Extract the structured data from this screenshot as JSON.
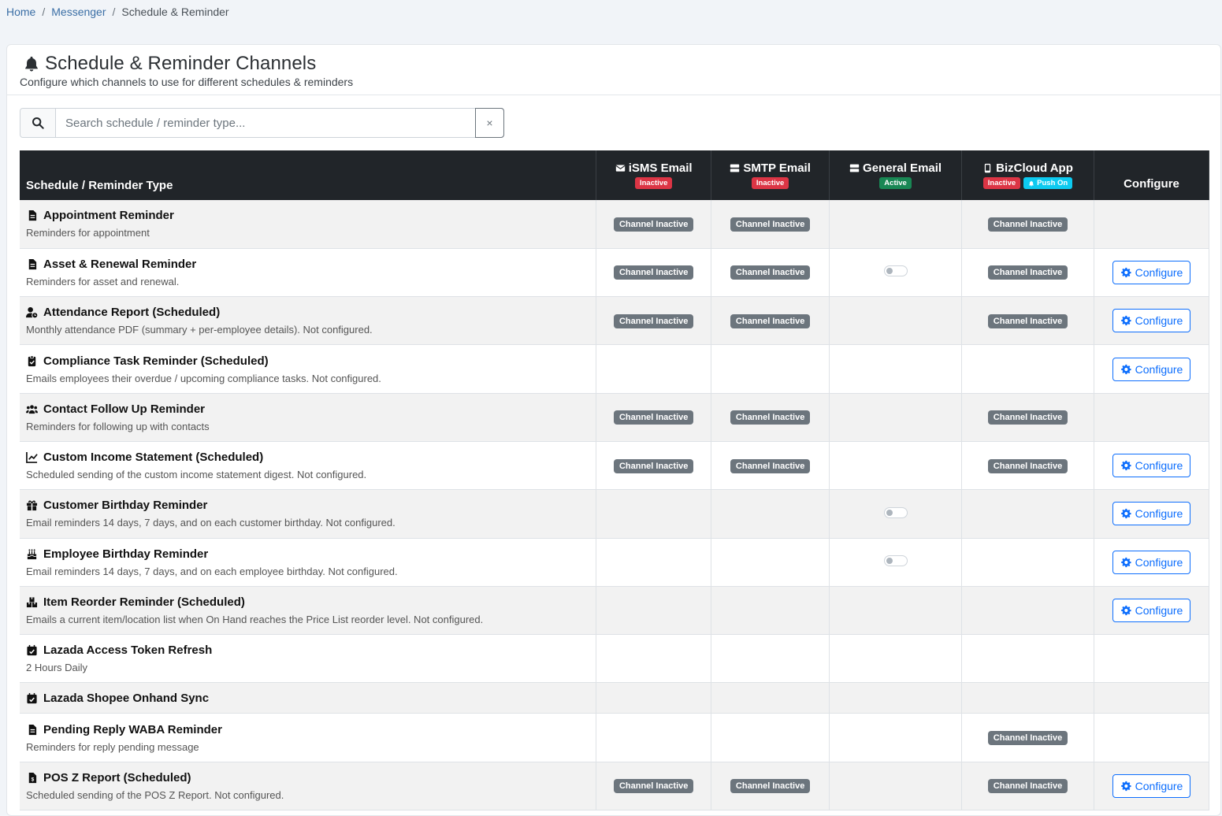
{
  "breadcrumb": {
    "home": "Home",
    "messenger": "Messenger",
    "current": "Schedule & Reminder"
  },
  "header": {
    "title": "Schedule & Reminder Channels",
    "subtitle": "Configure which channels to use for different schedules & reminders"
  },
  "search": {
    "placeholder": "Search schedule / reminder type...",
    "value": "",
    "clear": "×"
  },
  "table": {
    "col_type": "Schedule / Reminder Type",
    "col_configure": "Configure",
    "channels": {
      "isms": {
        "label": "iSMS Email",
        "status": "Inactive"
      },
      "smtp": {
        "label": "SMTP Email",
        "status": "Inactive"
      },
      "general": {
        "label": "General Email",
        "status": "Active"
      },
      "bizcloud": {
        "label": "BizCloud App",
        "status": "Inactive",
        "push": "Push On"
      }
    },
    "pill_label": "Channel Inactive",
    "configure_label": "Configure",
    "rows": [
      {
        "icon": "file-icon",
        "title": "Appointment Reminder",
        "desc": "Reminders for appointment",
        "isms": "pill",
        "smtp": "pill",
        "general": "",
        "biz": "pill",
        "cfg": false
      },
      {
        "icon": "file-icon",
        "title": "Asset & Renewal Reminder",
        "desc": "Reminders for asset and renewal.",
        "isms": "pill",
        "smtp": "pill",
        "general": "toggle",
        "biz": "pill",
        "cfg": true
      },
      {
        "icon": "user-clock-icon",
        "title": "Attendance Report (Scheduled)",
        "desc": "Monthly attendance PDF (summary + per-employee details). Not configured.",
        "isms": "pill",
        "smtp": "pill",
        "general": "",
        "biz": "pill",
        "cfg": true
      },
      {
        "icon": "clipboard-check-icon",
        "title": "Compliance Task Reminder (Scheduled)",
        "desc": "Emails employees their overdue / upcoming compliance tasks. Not configured.",
        "isms": "",
        "smtp": "",
        "general": "",
        "biz": "",
        "cfg": true
      },
      {
        "icon": "users-icon",
        "title": "Contact Follow Up Reminder",
        "desc": "Reminders for following up with contacts",
        "isms": "pill",
        "smtp": "pill",
        "general": "",
        "biz": "pill",
        "cfg": false
      },
      {
        "icon": "chart-line-icon",
        "title": "Custom Income Statement (Scheduled)",
        "desc": "Scheduled sending of the custom income statement digest. Not configured.",
        "isms": "pill",
        "smtp": "pill",
        "general": "",
        "biz": "pill",
        "cfg": true
      },
      {
        "icon": "gift-icon",
        "title": "Customer Birthday Reminder",
        "desc": "Email reminders 14 days, 7 days, and on each customer birthday. Not configured.",
        "isms": "",
        "smtp": "",
        "general": "toggle",
        "biz": "",
        "cfg": true
      },
      {
        "icon": "cake-icon",
        "title": "Employee Birthday Reminder",
        "desc": "Email reminders 14 days, 7 days, and on each employee birthday. Not configured.",
        "isms": "",
        "smtp": "",
        "general": "toggle",
        "biz": "",
        "cfg": true
      },
      {
        "icon": "boxes-icon",
        "title": "Item Reorder Reminder (Scheduled)",
        "desc": "Emails a current item/location list when On Hand reaches the Price List reorder level. Not configured.",
        "isms": "",
        "smtp": "",
        "general": "",
        "biz": "",
        "cfg": true
      },
      {
        "icon": "calendar-check-icon",
        "title": "Lazada Access Token Refresh",
        "desc": "2 Hours Daily",
        "isms": "",
        "smtp": "",
        "general": "",
        "biz": "",
        "cfg": false
      },
      {
        "icon": "calendar-check-icon",
        "title": "Lazada Shopee Onhand Sync",
        "desc": "",
        "isms": "",
        "smtp": "",
        "general": "",
        "biz": "",
        "cfg": false
      },
      {
        "icon": "file-icon",
        "title": "Pending Reply WABA Reminder",
        "desc": "Reminders for reply pending message",
        "isms": "",
        "smtp": "",
        "general": "",
        "biz": "pill",
        "cfg": false
      },
      {
        "icon": "file-invoice-icon",
        "title": "POS Z Report (Scheduled)",
        "desc": "Scheduled sending of the POS Z Report. Not configured.",
        "isms": "pill",
        "smtp": "pill",
        "general": "",
        "biz": "pill",
        "cfg": true
      }
    ]
  }
}
